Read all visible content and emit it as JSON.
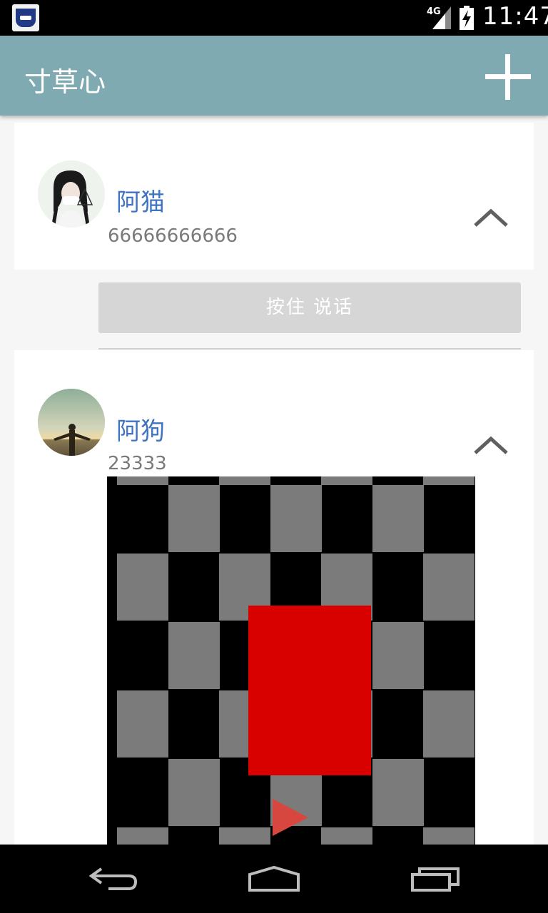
{
  "status_bar": {
    "network": "4G",
    "time": "11:47",
    "app_icon": "school-badge-icon",
    "signal_icon": "signal-icon",
    "battery_icon": "battery-charging-icon"
  },
  "app_bar": {
    "title": "寸草心",
    "add_icon": "plus-icon"
  },
  "posts": [
    {
      "name": "阿猫",
      "text": "66666666666",
      "avatar": "avatar-girl-icon",
      "toggle_icon": "chevron-up-icon"
    },
    {
      "name": "阿狗",
      "text": "23333",
      "avatar": "avatar-sunset-icon",
      "toggle_icon": "chevron-up-icon",
      "media": {
        "type": "video",
        "play_icon": "play-icon"
      }
    }
  ],
  "voice_button": {
    "label": "按住 说话"
  },
  "nav_bar": {
    "back_icon": "back-icon",
    "home_icon": "home-icon",
    "recents_icon": "recents-icon"
  },
  "colors": {
    "app_bar": "#7faab1",
    "username": "#3f73c4",
    "voice_button": "#d5d6d5",
    "media_red": "#d90000"
  }
}
